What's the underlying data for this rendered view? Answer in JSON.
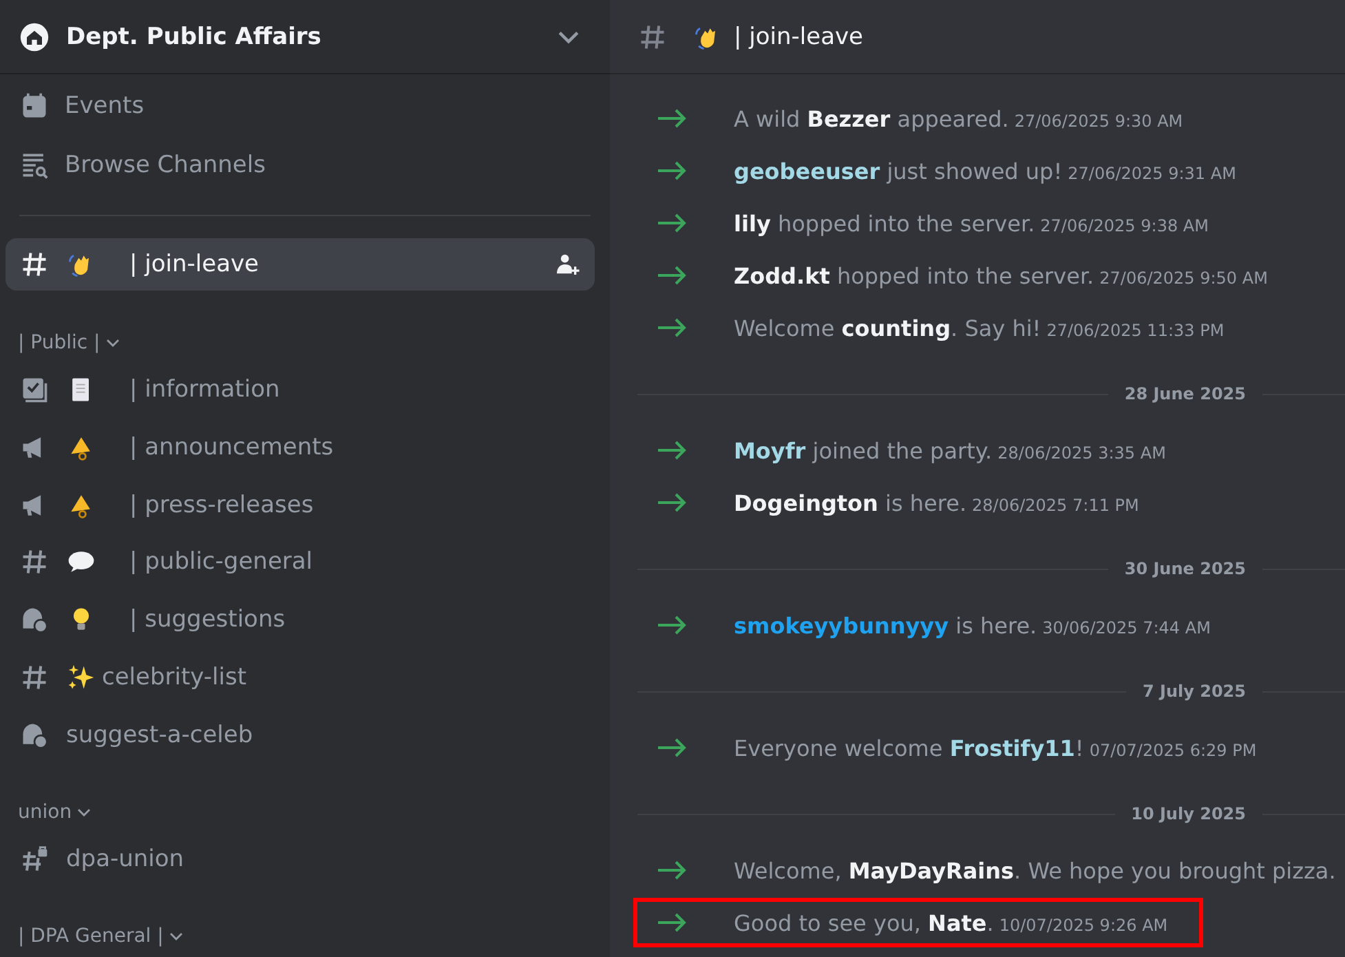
{
  "server": {
    "name": "Dept. Public Affairs"
  },
  "sidebar": {
    "top_items": [
      {
        "kind": "events",
        "label": "Events"
      },
      {
        "kind": "browse",
        "label": "Browse Channels"
      }
    ],
    "sections": [
      {
        "kind": "channel-only",
        "channels": [
          {
            "kind": "text",
            "label": "| join-leave",
            "selected": true
          }
        ]
      },
      {
        "kind": "category",
        "title": "| Public |",
        "channels": [
          {
            "kind": "rules",
            "label": "| information",
            "selected": false
          },
          {
            "kind": "announcement",
            "label": "| announcements",
            "selected": false
          },
          {
            "kind": "announcement",
            "label": "| press-releases",
            "selected": false
          },
          {
            "kind": "text",
            "label": "| public-general",
            "selected": false
          },
          {
            "kind": "forum",
            "label": "| suggestions",
            "selected": false
          },
          {
            "kind": "text",
            "label": "celebrity-list",
            "selected": false
          },
          {
            "kind": "forum",
            "label": "suggest-a-celeb",
            "selected": false
          }
        ]
      },
      {
        "kind": "category",
        "title": "union",
        "channels": [
          {
            "kind": "locked",
            "label": "dpa-union",
            "selected": false
          }
        ]
      },
      {
        "kind": "category",
        "title": "| DPA General |"
      }
    ]
  },
  "channel_header": {
    "label": "| join-leave"
  },
  "feed": [
    {
      "kind": "join",
      "before": "A wild ",
      "user": "Bezzer",
      "color": "#f2f3f5",
      "after": " appeared.",
      "time": "27/06/2025 9:30 AM",
      "highlighted": false
    },
    {
      "kind": "join",
      "user": "geobeeuser",
      "color": "#a3d9e6",
      "after": " just showed up!",
      "time": "27/06/2025 9:31 AM",
      "highlighted": false
    },
    {
      "kind": "join",
      "user": "lily",
      "color": "#f2f3f5",
      "after": " hopped into the server.",
      "time": "27/06/2025 9:38 AM",
      "highlighted": false
    },
    {
      "kind": "join",
      "user": "Zodd.kt",
      "color": "#f2f3f5",
      "after": " hopped into the server.",
      "time": "27/06/2025 9:50 AM",
      "highlighted": false
    },
    {
      "kind": "join",
      "before": "Welcome ",
      "user": "counting",
      "color": "#f2f3f5",
      "after": ". Say hi!",
      "time": "27/06/2025 11:33 PM",
      "highlighted": false
    },
    {
      "kind": "divider",
      "label": "28 June 2025"
    },
    {
      "kind": "join",
      "user": "Moyfr",
      "color": "#a3d9e6",
      "after": " joined the party.",
      "time": "28/06/2025 3:35 AM",
      "highlighted": false
    },
    {
      "kind": "join",
      "user": "Dogeington",
      "color": "#f2f3f5",
      "after": " is here.",
      "time": "28/06/2025 7:11 PM",
      "highlighted": false
    },
    {
      "kind": "divider",
      "label": "30 June 2025"
    },
    {
      "kind": "join",
      "user": "smokeyybunnyyy",
      "color": "#1fa3f0",
      "after": " is here.",
      "time": "30/06/2025 7:44 AM",
      "highlighted": false
    },
    {
      "kind": "divider",
      "label": "7 July 2025"
    },
    {
      "kind": "join",
      "before": "Everyone welcome ",
      "user": "Frostify11",
      "color": "#a3d9e6",
      "after": "!",
      "time": "07/07/2025 6:29 PM",
      "highlighted": false
    },
    {
      "kind": "divider",
      "label": "10 July 2025"
    },
    {
      "kind": "join",
      "before": "Welcome, ",
      "user": "MayDayRains",
      "color": "#f2f3f5",
      "after": ". We hope you brought pizza.",
      "highlighted": false
    },
    {
      "kind": "join",
      "before": "Good to see you, ",
      "user": "Nate",
      "color": "#f2f3f5",
      "after": ".",
      "time": "10/07/2025 9:26 AM",
      "highlighted": true
    }
  ]
}
